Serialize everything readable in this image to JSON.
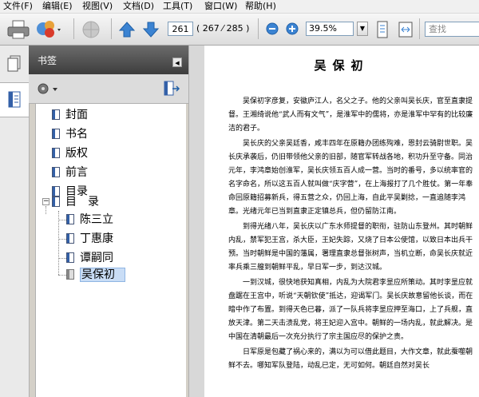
{
  "menu": [
    "文件(F)",
    "编辑(E)",
    "视图(V)",
    "文档(D)",
    "工具(T)",
    "窗口(W)",
    "帮助(H)"
  ],
  "toolbar": {
    "current_page": "261",
    "page_count": "( 267 ⁄ 285 )",
    "zoom": "39.5%",
    "search_placeholder": "查找"
  },
  "panel": {
    "title": "书签",
    "bookmarks": [
      "封面",
      "书名",
      "版权",
      "前言",
      "目录",
      "目　录",
      "陈三立",
      "丁惠康",
      "谭嗣同",
      "吴保初"
    ]
  },
  "document": {
    "title": "吴保初",
    "paragraphs": [
      "吴保初字彦复，安徽庐江人，名父之子。他的父亲叫吴长庆，官至直隶提督。王湘绮说他“武人而有文气”，是淮军中的儒将，亦是淮军中罕有的比较廉洁的君子。",
      "吴长庆的父亲吴廷香，咸丰四年在原籍办团练殉难，恩封云骑尉世职。吴长庆承袭后，仍旧带领他父亲的旧部，随官军转战各地，积功升至守备。同治元年，李鸿章始创淮军，吴长庆领五百人成一营。当时的番号，多以统率官的名字命名，所以这五百人就叫做“庆字营”，在上海报打了几个胜仗。第一年奉命回原籍招募新兵，得五营之众，仍回上海，自此平吴剿捻，一直追随李鸿章。光绪元年已当到直隶正定镇总兵，但仍留防江南。",
      "到得光绪八年，吴长庆以广东水师提督的职衔，驻防山东登州。其时朝鲜内乱，禁军犯王宫，杀大臣，王妃失踪，又烧了日本公使馆，以致日本出兵干预。当时朝鲜是中国的藩属，署理直隶总督张树声，当机立断，命吴长庆就近率兵乘三艘到朝鲜平乱，早日军一步，到达汉城。",
      "一到汉城，很快地获知真相，内乱为大院君李昰应所策动。其时李昰应就盘踞在王宫中，听说“天朝钦使”抵达，迎谒军门。吴长庆故意留他长谈，而在暗中作了布置。到得天色已暮，派了一队兵将李昰应押至海口，上了兵舰，直放天津。第二天击溃乱党，将王妃迎入宫中。朝鲜的一场内乱，就此解决。是中国在清朝最后一次充分执行了宗主国应尽的保护之责。",
      "日军原是包藏了祸心来的，满以为可以借此题目，大作文章，就此蚕噬朝鲜不去。哪知军队登陆，动乱已定，无可如何。朝廷自然对吴长"
    ]
  }
}
